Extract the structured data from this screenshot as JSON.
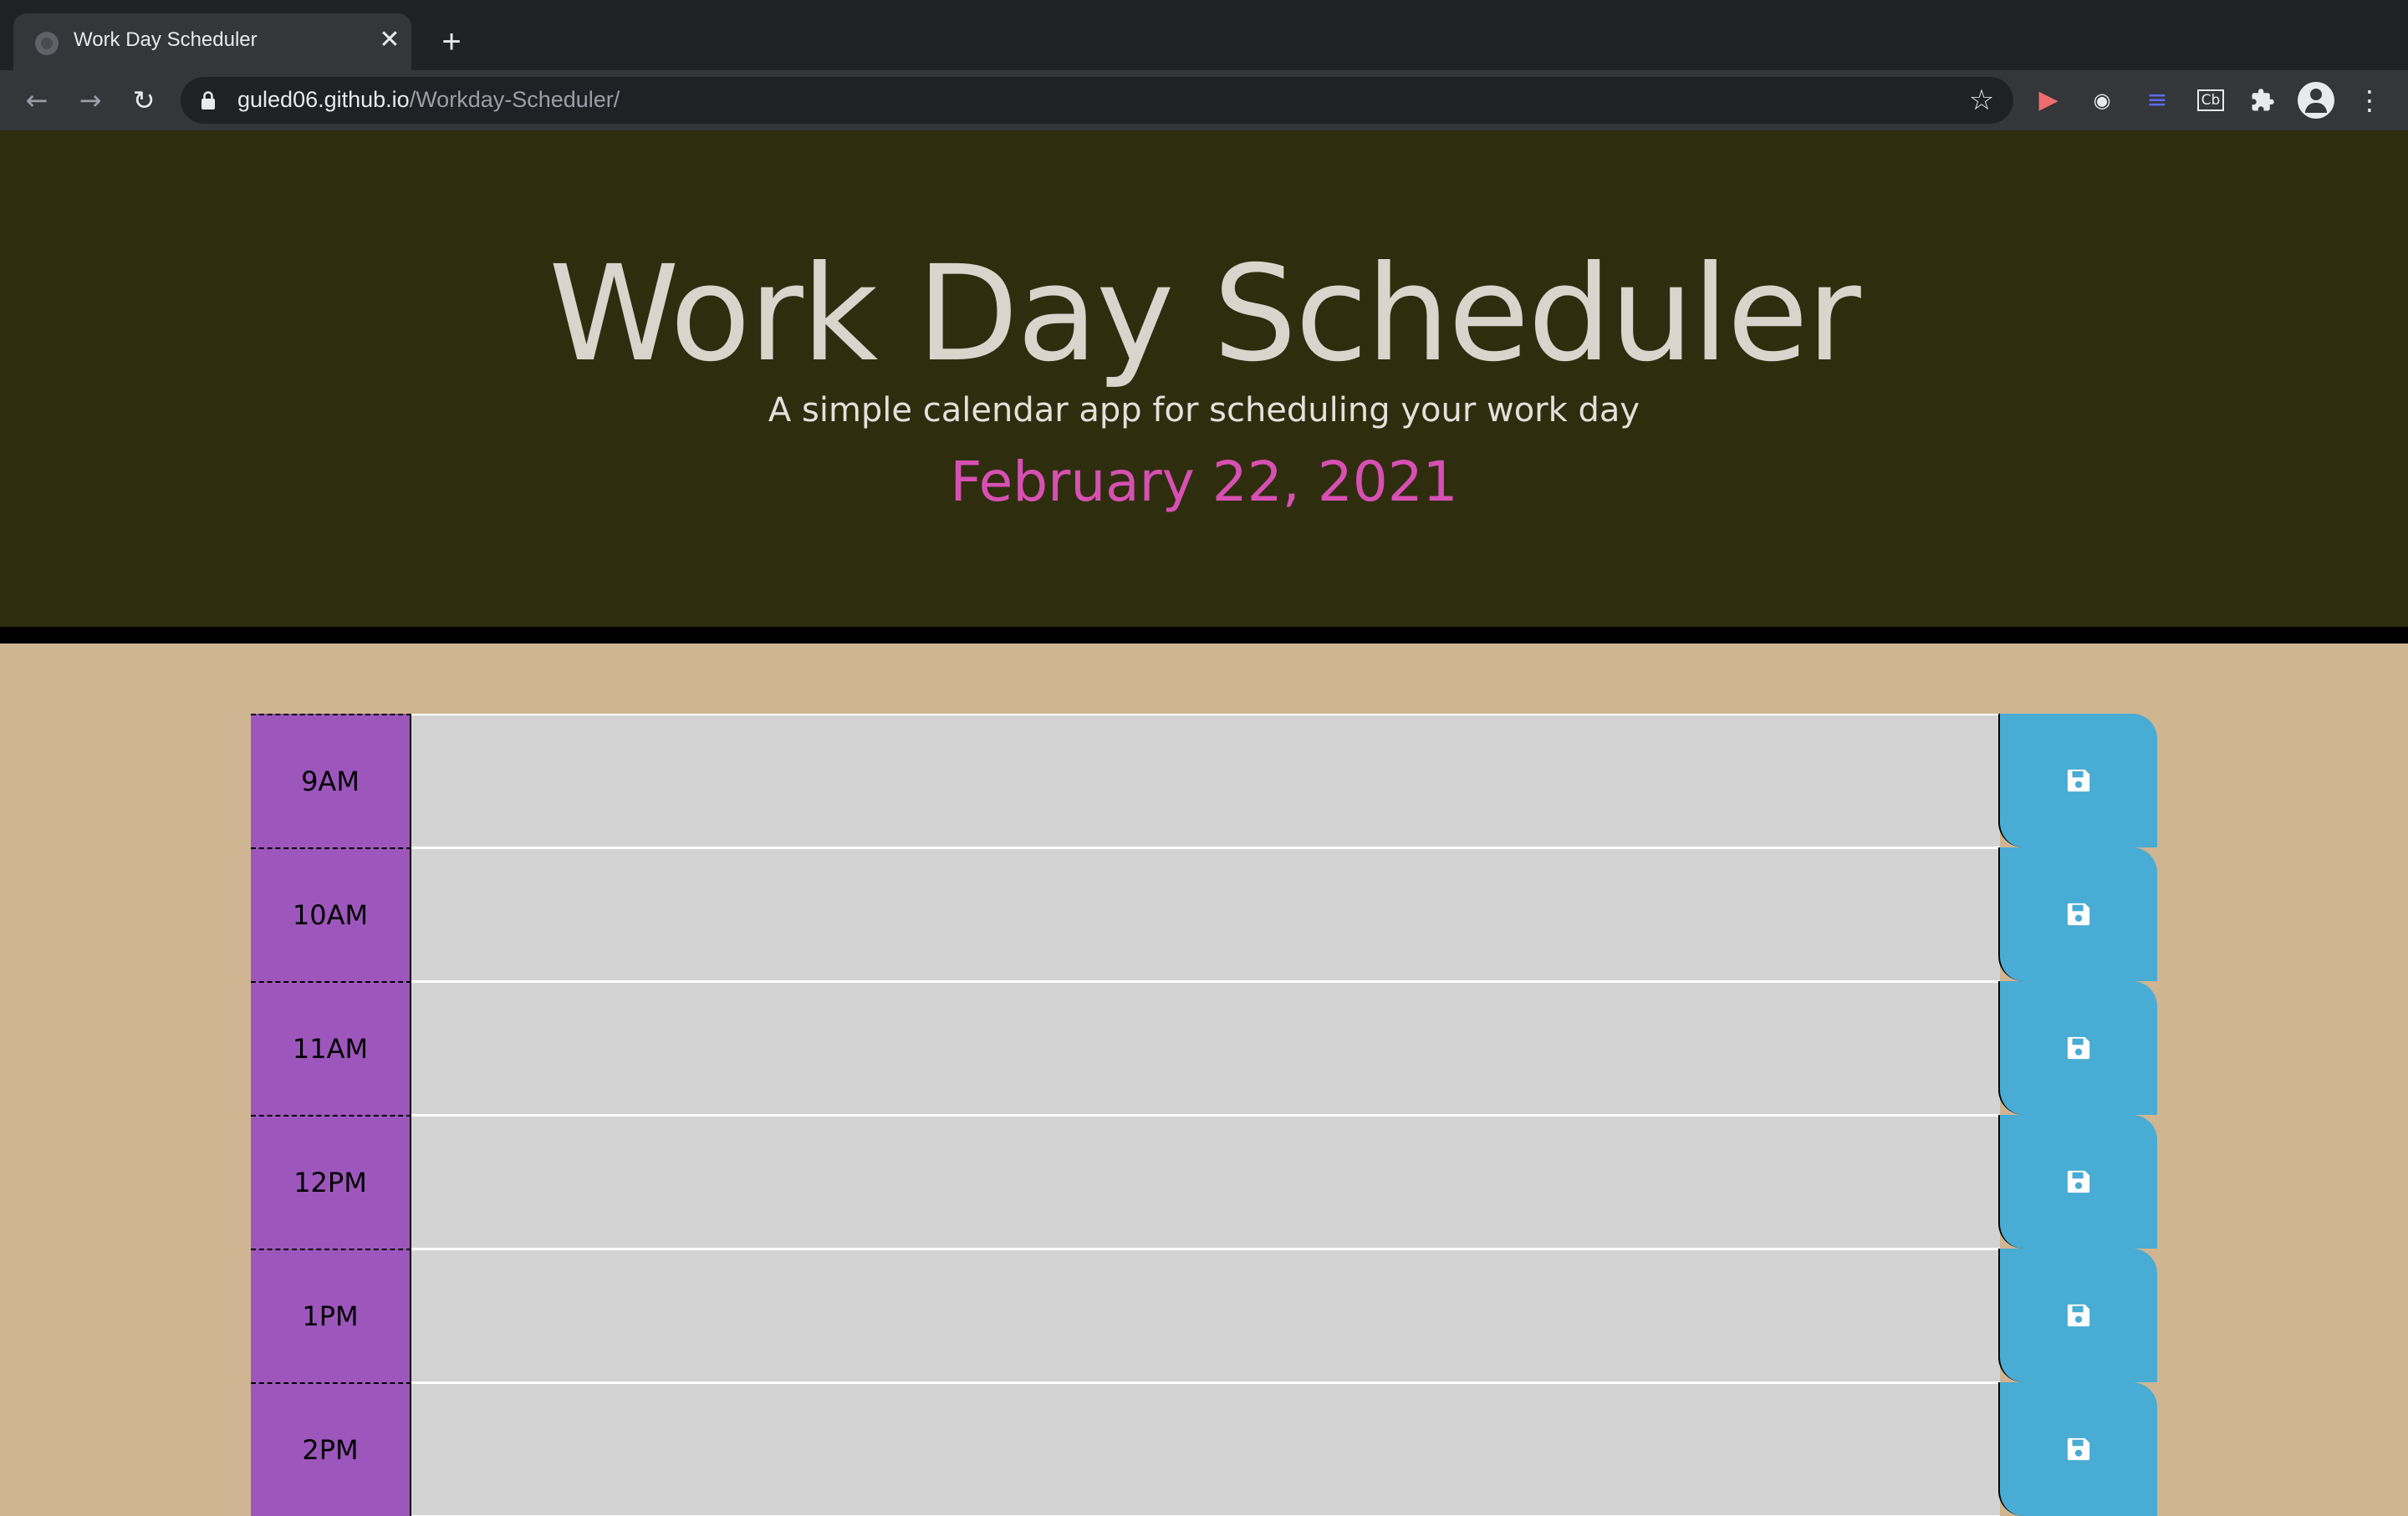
{
  "browser": {
    "tab_title": "Work Day Scheduler",
    "tab_close": "✕",
    "new_tab": "+",
    "url_host": "guled06.github.io",
    "url_path": "/Workday-Scheduler/",
    "back": "←",
    "forward": "→",
    "reload": "↻",
    "bookmark": "☆",
    "extensions": [
      "video-ext-icon",
      "circle-ext-icon",
      "lines-ext-icon",
      "cb-ext-icon",
      "puzzle-icon",
      "profile-icon",
      "menu-icon"
    ],
    "ext_cb_label": "Cb"
  },
  "header": {
    "title": "Work Day Scheduler",
    "subtitle": "A simple calendar app for scheduling your work day",
    "current_day": "February 22, 2021"
  },
  "schedule": {
    "hours": [
      {
        "label": "9AM",
        "description": ""
      },
      {
        "label": "10AM",
        "description": ""
      },
      {
        "label": "11AM",
        "description": ""
      },
      {
        "label": "12PM",
        "description": ""
      },
      {
        "label": "1PM",
        "description": ""
      },
      {
        "label": "2PM",
        "description": ""
      }
    ]
  },
  "colors": {
    "header_bg": "#2e2e0f",
    "page_bg": "#cfb592",
    "hour_bg": "#9d56bc",
    "past_bg": "#d3d3d3",
    "save_bg": "#48acd4",
    "date_color": "#d84fb3"
  }
}
